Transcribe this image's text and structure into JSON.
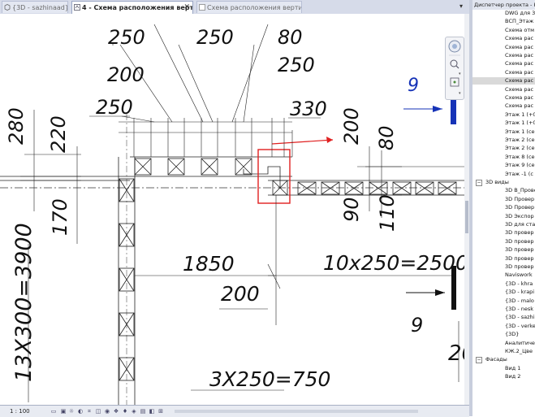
{
  "tabs": [
    {
      "label": "{3D - sazhinaad}",
      "state": "inactive"
    },
    {
      "label": "4 - Схема расположения верти...",
      "state": "active",
      "close": "✕"
    },
    {
      "label": "Схема расположения вертикальн...",
      "state": "inactive"
    }
  ],
  "tab_menu_icon": "▾",
  "drawing": {
    "dims": {
      "top_250_left": "250",
      "top_250_mid": "250",
      "top_80": "80",
      "top_200": "200",
      "top_250_right": "250",
      "left_250": "250",
      "right_330": "330",
      "left_280": "280",
      "left_220": "220",
      "right_200": "200",
      "right_80": "80",
      "left_170": "170",
      "right_90": "90",
      "right_110": "110",
      "mid_1850": "1850",
      "mid_200": "200",
      "long_10x250": "10x250=2500",
      "vert_13x300": "13X300=3900",
      "bottom_3x250": "3X250=750",
      "section_9_top": "9",
      "section_9_bottom": "9",
      "partial_20": "20"
    },
    "colors": {
      "section_marker": "#1633b7",
      "highlight_box": "#e02020",
      "arrow": "#e02020"
    }
  },
  "status_bar": {
    "scale": "1 : 100"
  },
  "project_browser": {
    "title": "Диспетчер проекта - К",
    "items": [
      {
        "label": "DWG для 3",
        "indent": 2
      },
      {
        "label": "ВСП_Этаж",
        "indent": 2
      },
      {
        "label": "Схема отм",
        "indent": 2
      },
      {
        "label": "Схема рас",
        "indent": 2
      },
      {
        "label": "Схема рас",
        "indent": 2
      },
      {
        "label": "Схема рас",
        "indent": 2
      },
      {
        "label": "Схема рас",
        "indent": 2
      },
      {
        "label": "Схема рас",
        "indent": 2
      },
      {
        "label": "Схема рас",
        "indent": 2,
        "selected": true
      },
      {
        "label": "Схема рас",
        "indent": 2
      },
      {
        "label": "Схема рас",
        "indent": 2
      },
      {
        "label": "Схема рас",
        "indent": 2
      },
      {
        "label": "Этаж 1 (+0",
        "indent": 2
      },
      {
        "label": "Этаж 1 (+0",
        "indent": 2
      },
      {
        "label": "Этаж 1 (се",
        "indent": 2
      },
      {
        "label": "Этаж 2 (се",
        "indent": 2
      },
      {
        "label": "Этаж 2 (се",
        "indent": 2
      },
      {
        "label": "Этаж 8 (се",
        "indent": 2
      },
      {
        "label": "Этаж 9 (се",
        "indent": 2
      },
      {
        "label": "Этаж -1 (с",
        "indent": 2
      },
      {
        "label": "3D виды",
        "indent": 1,
        "group": true,
        "expander": "−"
      },
      {
        "label": "3D В_Прове",
        "indent": 2
      },
      {
        "label": "3D Провер",
        "indent": 2
      },
      {
        "label": "3D Провер",
        "indent": 2
      },
      {
        "label": "3D Экспор",
        "indent": 2
      },
      {
        "label": "3D для ста",
        "indent": 2
      },
      {
        "label": "3D провер",
        "indent": 2
      },
      {
        "label": "3D провер",
        "indent": 2
      },
      {
        "label": "3D провер",
        "indent": 2
      },
      {
        "label": "3D провер",
        "indent": 2
      },
      {
        "label": "3D провер",
        "indent": 2
      },
      {
        "label": "Naviswork",
        "indent": 2
      },
      {
        "label": "{3D - khra",
        "indent": 2
      },
      {
        "label": "{3D - krapi",
        "indent": 2
      },
      {
        "label": "{3D - malo",
        "indent": 2
      },
      {
        "label": "{3D - nesk",
        "indent": 2
      },
      {
        "label": "{3D - sazhi",
        "indent": 2
      },
      {
        "label": "{3D - verke",
        "indent": 2
      },
      {
        "label": "{3D}",
        "indent": 2
      },
      {
        "label": "Аналитиче",
        "indent": 2
      },
      {
        "label": "КЖ.2_Цве",
        "indent": 2
      },
      {
        "label": "Фасады",
        "indent": 1,
        "group": true,
        "expander": "−"
      },
      {
        "label": "Вид 1",
        "indent": 2
      },
      {
        "label": "Вид 2",
        "indent": 2
      }
    ]
  }
}
